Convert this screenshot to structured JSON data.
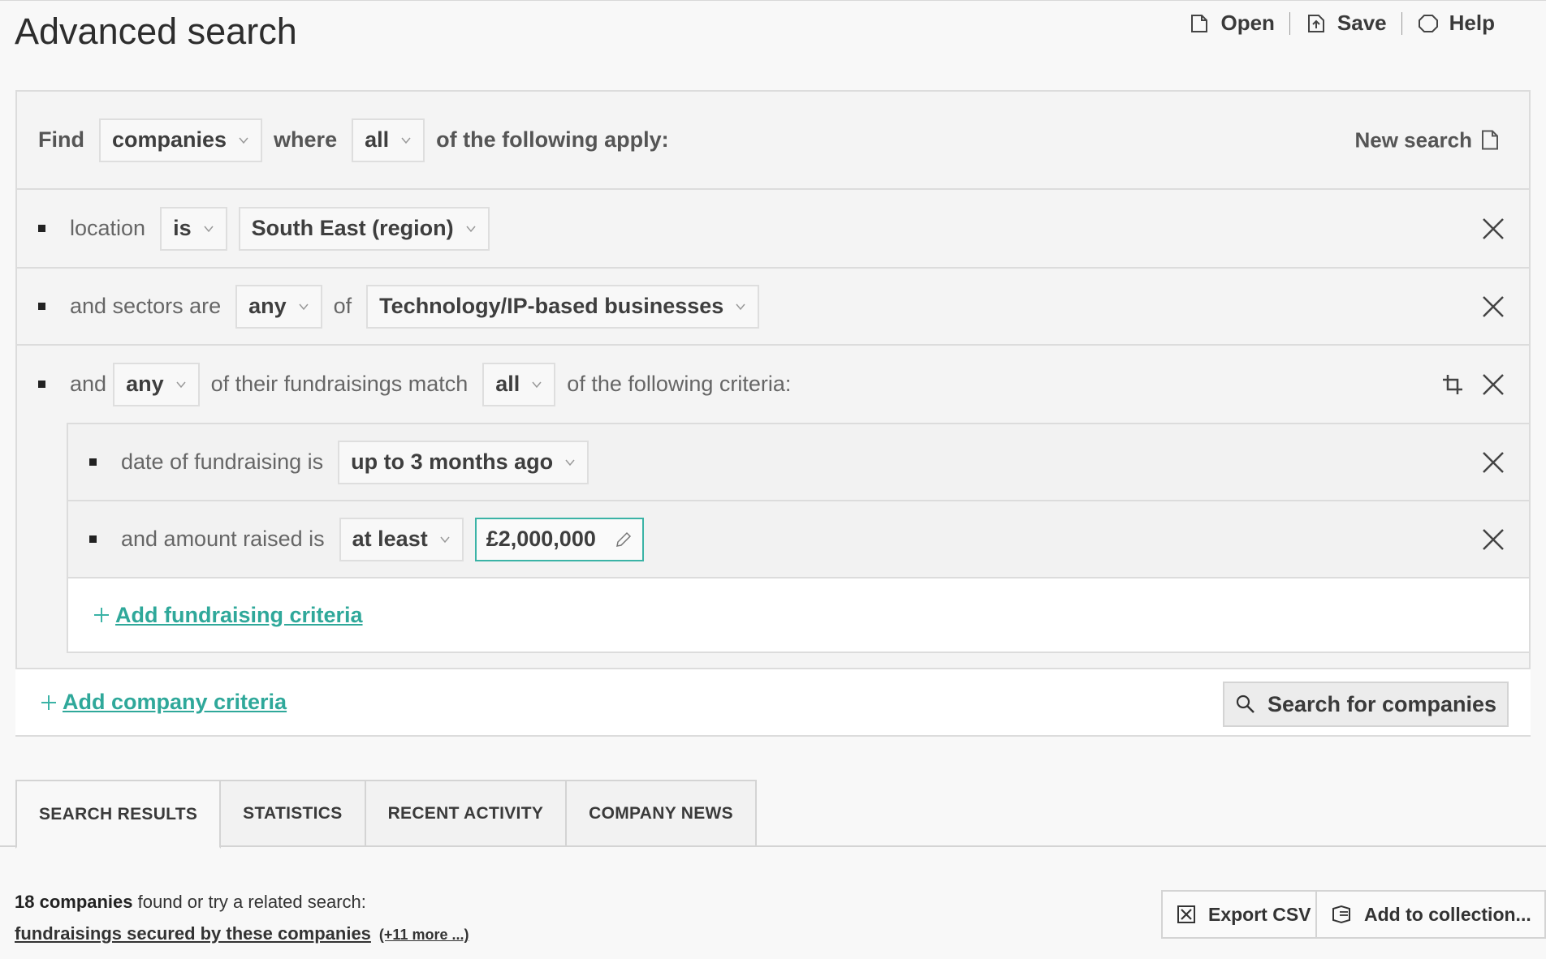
{
  "header": {
    "title": "Advanced search",
    "actions": [
      {
        "label": "Open",
        "icon": "folder-icon"
      },
      {
        "label": "Save",
        "icon": "save-icon"
      },
      {
        "label": "Help",
        "icon": "help-icon"
      }
    ]
  },
  "builder": {
    "find_label": "Find",
    "entity": "companies",
    "where_label": "where",
    "quantifier": "all",
    "apply_label": "of the following apply:",
    "new_search": "New search",
    "criteria": {
      "location": {
        "label": "location",
        "operator": "is",
        "value": "South East (region)"
      },
      "sectors": {
        "label": "and sectors are",
        "quantifier": "any",
        "of_label": "of",
        "value": "Technology/IP-based businesses"
      },
      "fundraising": {
        "and_label": "and",
        "quantifier": "any",
        "match_label": "of their fundraisings match",
        "match_quantifier": "all",
        "criteria_label": "of the following criteria:",
        "date": {
          "label": "date of fundraising is",
          "value": "up to 3 months ago"
        },
        "amount": {
          "label": "and amount raised is",
          "operator": "at least",
          "value": "£2,000,000"
        },
        "add_link": "Add fundraising criteria"
      }
    },
    "add_company_link": "Add company criteria",
    "search_button": "Search for companies"
  },
  "tabs": [
    {
      "label": "SEARCH RESULTS",
      "active": true
    },
    {
      "label": "STATISTICS",
      "active": false
    },
    {
      "label": "RECENT ACTIVITY",
      "active": false
    },
    {
      "label": "COMPANY NEWS",
      "active": false
    }
  ],
  "results": {
    "count": "18 companies",
    "found_text": " found or try a related search:",
    "related_link": "fundraisings secured by these companies",
    "more_link": "(+11 more ...)"
  },
  "buttons": {
    "export_csv": "Export CSV",
    "add_to_collection": "Add to collection..."
  },
  "colors": {
    "accent": "#3bb3a6",
    "link": "#2fa89a"
  }
}
